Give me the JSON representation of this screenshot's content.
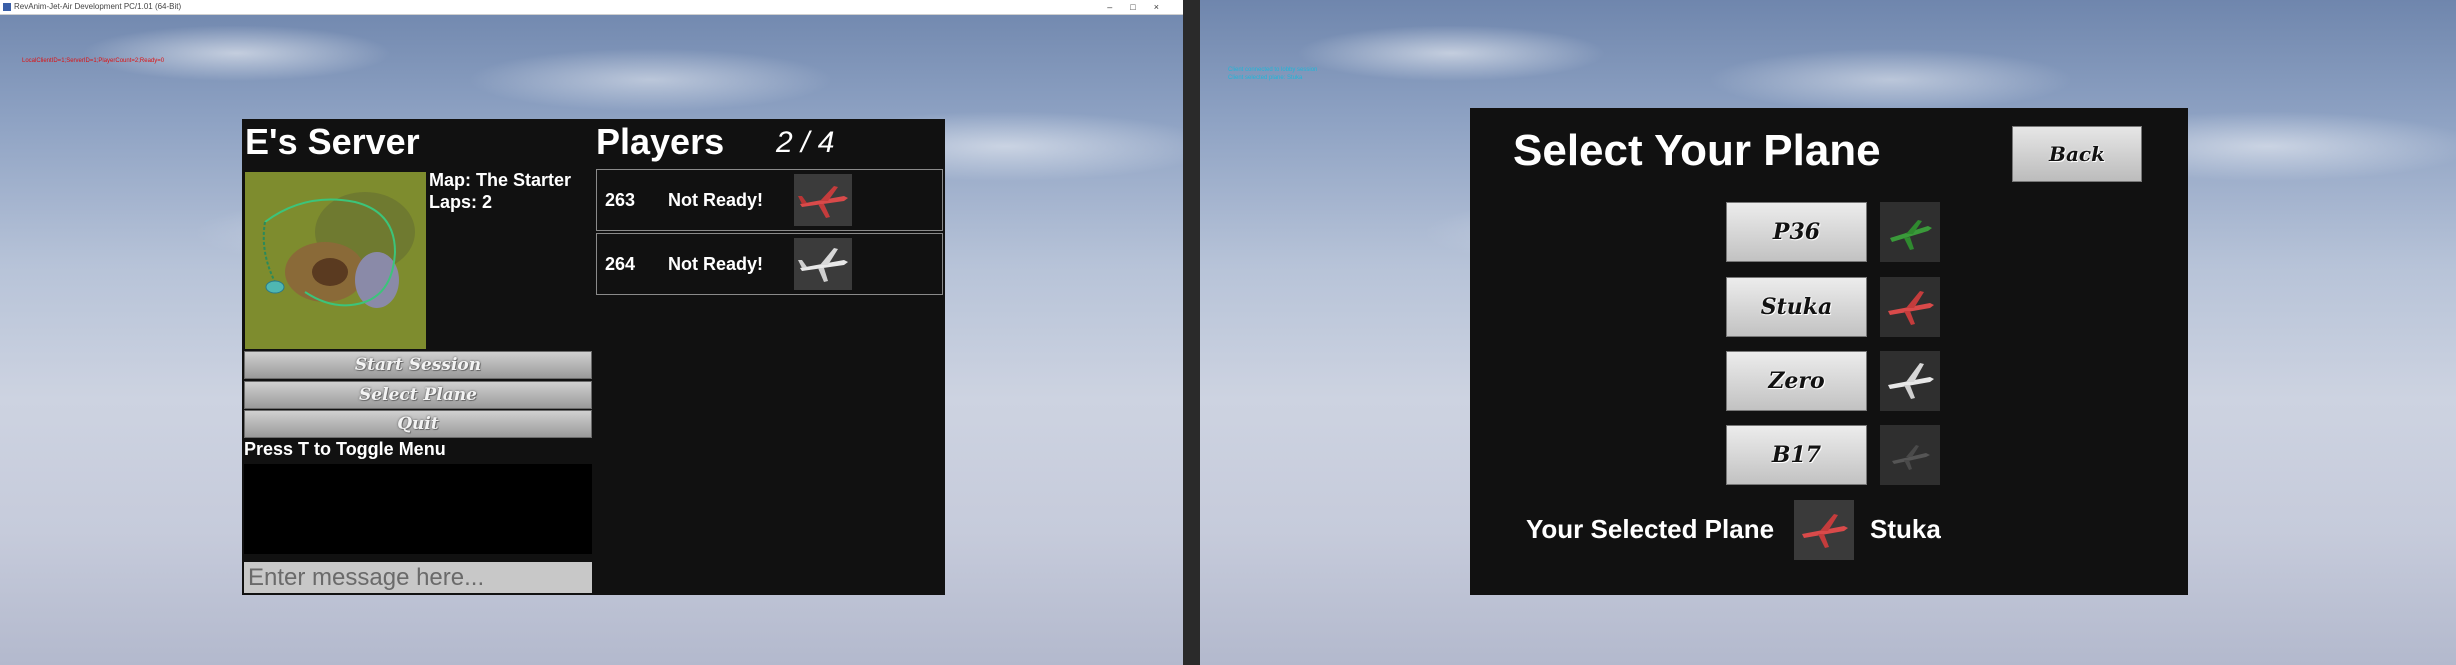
{
  "window": {
    "title": "RevAnim-Jet-Air Development PC/1.01 (64-Bit)",
    "buttons": [
      "–",
      "□",
      "×"
    ]
  },
  "debug": {
    "left_text": "LocalClientID=1;ServerID=1;PlayerCount=2;Ready=0",
    "right_text_line1": "Client connected to lobby session",
    "right_text_line2": "Client selected plane: Stuka"
  },
  "lobby": {
    "server_name": "E's Server",
    "map_label": "Map: The Starter",
    "laps_label": "Laps: 2",
    "buttons": {
      "start": "Start Session",
      "select_plane": "Select Plane",
      "quit": "Quit"
    },
    "toggle_hint": "Press T to Toggle Menu",
    "chat_placeholder": "Enter message here...",
    "players_title": "Players",
    "player_count": "2 / 4",
    "players": [
      {
        "id": "263",
        "status": "Not Ready!",
        "plane_icon": "red-plane-icon"
      },
      {
        "id": "264",
        "status": "Not Ready!",
        "plane_icon": "white-plane-icon"
      }
    ]
  },
  "plane_select": {
    "title": "Select Your Plane",
    "back_label": "Back",
    "planes": [
      {
        "label": "P36",
        "icon": "green-plane-icon",
        "color": "#3a9a3a"
      },
      {
        "label": "Stuka",
        "icon": "red-plane-icon",
        "color": "#d94a4a"
      },
      {
        "label": "Zero",
        "icon": "white-plane-icon",
        "color": "#e8e8e8"
      },
      {
        "label": "B17",
        "icon": "dark-plane-icon",
        "color": "#555555"
      }
    ],
    "selected_label": "Your Selected Plane",
    "selected_plane": "Stuka"
  }
}
